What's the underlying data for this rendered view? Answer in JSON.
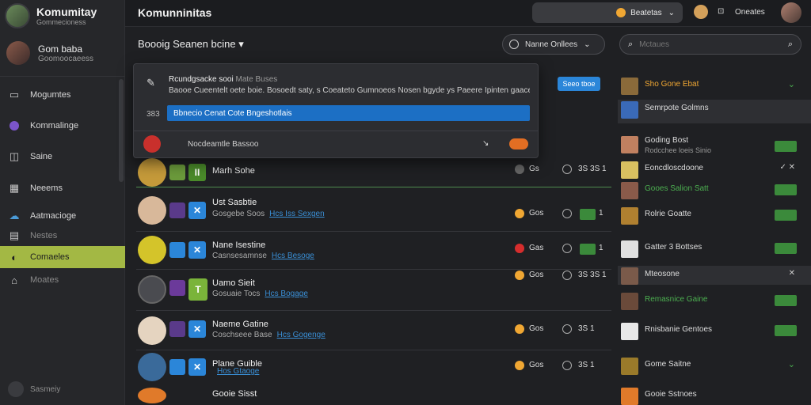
{
  "sidebar": {
    "brand_title": "Komumitay",
    "brand_sub": "Gommecioness",
    "user_name": "Gom baba",
    "user_sub": "Goomoocaeess",
    "items": [
      {
        "label": "Mogumtes",
        "icon": "inbox-icon"
      },
      {
        "label": "Kommalinge",
        "icon": "community-icon"
      },
      {
        "label": "Saine",
        "icon": "board-icon"
      },
      {
        "label": "Neeems",
        "icon": "calendar-icon"
      },
      {
        "label": "Aatmacioge",
        "icon": "cloud-icon"
      },
      {
        "label": "Nestes",
        "icon": "grid-icon"
      },
      {
        "label": "Comaeles",
        "icon": "leaf-icon"
      },
      {
        "label": "Moates",
        "icon": "home-icon"
      }
    ],
    "footer": "Sasmeiy"
  },
  "topbar": {
    "title": "Komunninitas",
    "select_label": "Beatetas",
    "user_label": "Oneates"
  },
  "section": {
    "title": "Boooig Seanen bcine",
    "filter_label": "Nanne Onllees",
    "search_placeholder": "Mctaues"
  },
  "popup": {
    "title": "Rcundgsacke sooi",
    "title_extra": "Mate Buses",
    "desc": "Baooe Cueentelt oete boie. Bosoedt saty, s Coeateto Gumnoeos Nosen bgyde ys Paeere Ipinten gaacemnee",
    "num": "383",
    "input_value": "Bbnecio Cenat Cote Bngeshotlais",
    "row_label": "Nocdeamtle Bassoo"
  },
  "blue_button": "Seeo tboe",
  "rows": [
    {
      "name": "Marh Sohe",
      "sub": "",
      "link": "",
      "coin": "Gs",
      "time": "3S 3S 1",
      "gb": "",
      "coin_color": "#888"
    },
    {
      "name": "Ust Sasbtie",
      "sub": "Gosgebe Soos",
      "link": "Hcs Iss Sexgen",
      "coin": "Gos",
      "time": "",
      "gb": "1",
      "coin_color": "#f0a733"
    },
    {
      "name": "Nane Isestine",
      "sub": "Casnsesamnse",
      "link": "Hcs Besoge",
      "coin": "Gas",
      "time": "",
      "gb": "1",
      "coin_color": "#d62d2d"
    },
    {
      "name": "Uamo Sieit",
      "sub": "Gosuaie Tocs",
      "link": "Hcs Bogage",
      "coin": "Gos",
      "time": "3S 3S 1",
      "gb": "",
      "coin_color": "#f0a733"
    },
    {
      "name": "Naeme Gatine",
      "sub": "Coschseee Base",
      "link": "Hcs Gogenge",
      "coin": "Gos",
      "time": "3S 1",
      "gb": "",
      "coin_color": "#f0a733"
    },
    {
      "name": "Plane Guible",
      "sub": "",
      "link": "Hos Gtaoge",
      "coin": "Gos",
      "time": "3S 1",
      "gb": "",
      "coin_color": "#f0a733"
    },
    {
      "name": "Gooie Sisst",
      "sub": "",
      "link": "",
      "coin": "",
      "time": "",
      "gb": "",
      "coin_color": "#888"
    }
  ],
  "right_panel": [
    {
      "label": "Sho Gone Ebat",
      "sub": "",
      "trail": "chev"
    },
    {
      "label": "Semrpote Golmns",
      "sub": "",
      "trail": ""
    },
    {
      "label": "Goding Bost",
      "sub": "Rodcchee loeis Sinio",
      "trail": "act"
    },
    {
      "label": "Eoncdloscdoone",
      "sub": "",
      "trail": "x"
    },
    {
      "label": "Gooes Salion Satt",
      "sub": "",
      "trail": "act"
    },
    {
      "label": "Rolrie Goatte",
      "sub": "",
      "trail": "act"
    },
    {
      "label": "Gatter 3 Bottses",
      "sub": "",
      "trail": "act"
    },
    {
      "label": "Mteosone",
      "sub": "",
      "trail": "x"
    },
    {
      "label": "Remasnice Gaine",
      "sub": "",
      "trail": "act"
    },
    {
      "label": "Rnisbanie Gentoes",
      "sub": "",
      "trail": "act"
    },
    {
      "label": "Gome Saitne",
      "sub": "",
      "trail": "chev"
    },
    {
      "label": "Gooie Sstnoes",
      "sub": "",
      "trail": ""
    }
  ],
  "colors": {
    "accent": "#a3b844",
    "primary": "#2b86d9",
    "success": "#3b8a3b"
  }
}
